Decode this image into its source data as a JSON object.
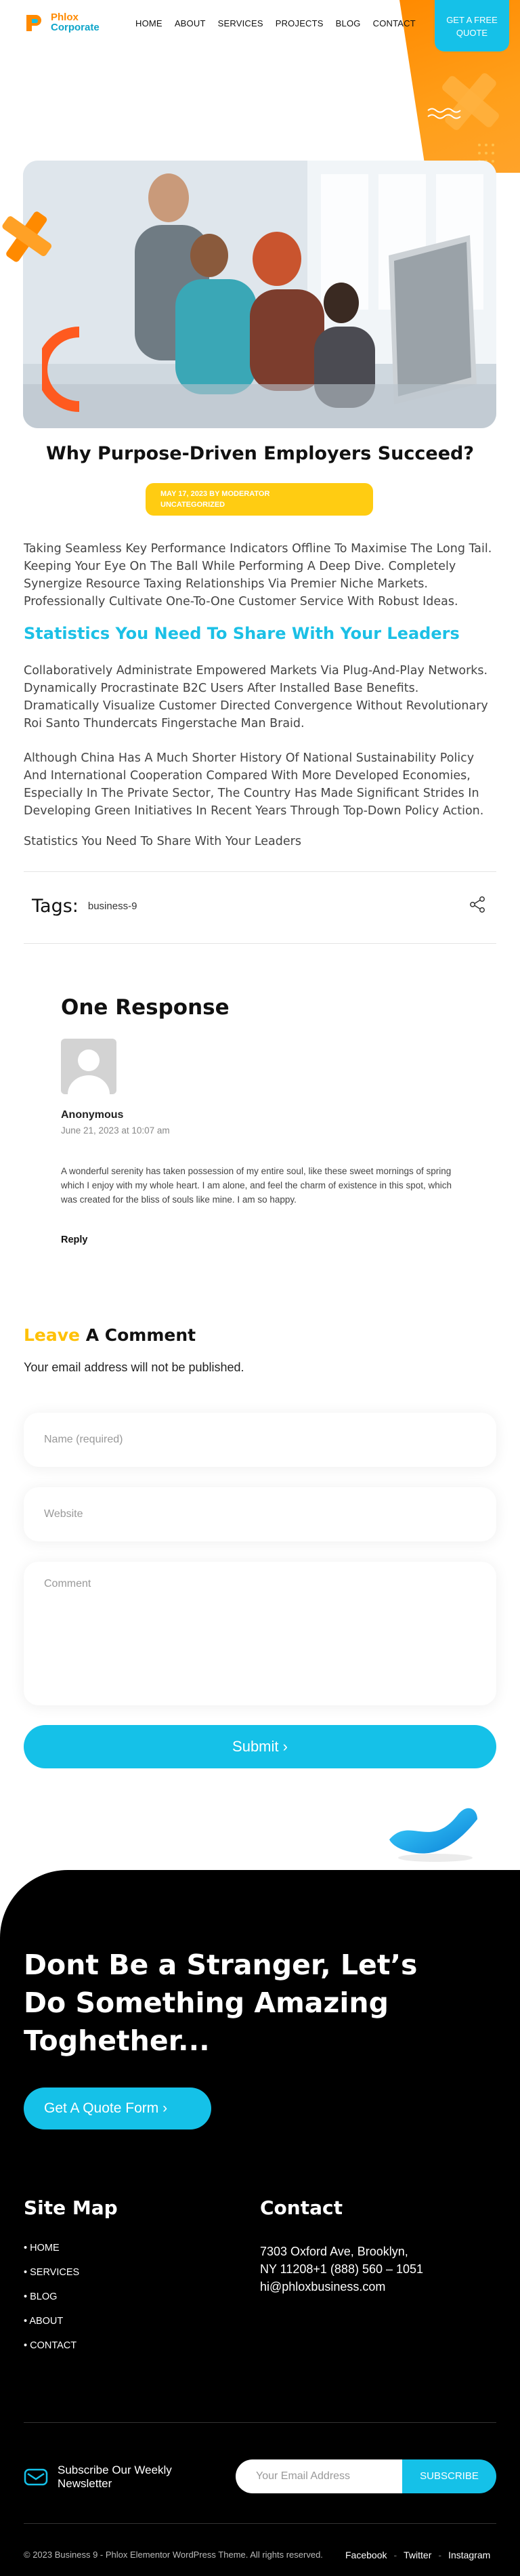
{
  "brand": {
    "line1": "Phlox",
    "line2": "Corporate"
  },
  "nav": [
    "HOME",
    "ABOUT",
    "SERVICES",
    "PROJECTS",
    "BLOG",
    "CONTACT"
  ],
  "quote_button": {
    "line1": "GET A FREE",
    "line2": "QUOTE"
  },
  "post": {
    "title": "Why Purpose-Driven Employers Succeed?",
    "meta_line1": "MAY 17, 2023   BY MODERATOR",
    "meta_line2": "UNCATEGORIZED",
    "intro": "Taking Seamless Key Performance Indicators Offline To Maximise The Long Tail. Keeping Your Eye On The Ball While Performing A Deep Dive. Completely Synergize Resource Taxing Relationships Via Premier Niche Markets. Professionally Cultivate One-To-One Customer Service With Robust Ideas.",
    "subheading": "Statistics You Need To Share With Your Leaders",
    "para2": "Collaboratively Administrate Empowered Markets Via Plug-And-Play Networks. Dynamically Procrastinate B2C Users After Installed Base Benefits. Dramatically Visualize Customer Directed Convergence Without Revolutionary Roi Santo Thundercats Fingerstache Man Braid.",
    "para3": "Although China Has A Much Shorter History Of National Sustainability Policy And International Cooperation Compared With More Developed Economies, Especially In The Private Sector, The Country Has Made Significant Strides In Developing Green Initiatives In Recent Years Through Top-Down Policy Action.",
    "para4": "Statistics You Need To Share With Your Leaders",
    "tags_label": "Tags:",
    "tag": "business-9"
  },
  "comments": {
    "title": "One Response",
    "author": "Anonymous",
    "date": "June 21, 2023 at 10:07 am",
    "text": "A wonderful serenity has taken possession of my entire soul, like these sweet mornings of spring which I enjoy with my whole heart. I am alone, and feel the charm of existence in this spot, which was created for the bliss of souls like mine. I am so happy.",
    "reply": "Reply"
  },
  "form": {
    "heading_accent": "Leave",
    "heading_rest": " A Comment",
    "note": "Your email address will not be published.",
    "name_placeholder": "Name (required)",
    "website_placeholder": "Website",
    "comment_placeholder": "Comment",
    "submit": "Submit  ›"
  },
  "footer": {
    "cta": "Dont Be a Stranger, Let’s Do Something Amazing Toghether...",
    "cta_button": "Get A Quote Form  ›",
    "sitemap_title": "Site Map",
    "sitemap": [
      "HOME",
      "SERVICES",
      "BLOG",
      "ABOUT",
      "CONTACT"
    ],
    "contact_title": "Contact",
    "address1": "7303 Oxford Ave, Brooklyn,",
    "address2": "NY 11208+1 (888) 560 – 1051",
    "email": "hi@phloxbusiness.com",
    "newsletter": "Subscribe Our Weekly Newsletter",
    "email_placeholder": "Your Email Address",
    "subscribe": "SUBSCRIBE",
    "copyright": "© 2023 Business 9 - Phlox Elementor WordPress Theme. All rights reserved.",
    "social": [
      "Facebook",
      "Twitter",
      "Instagram"
    ]
  },
  "colors": {
    "accent": "#15c1e8",
    "orange": "#ff8a00",
    "yellow": "#ffcc12"
  }
}
